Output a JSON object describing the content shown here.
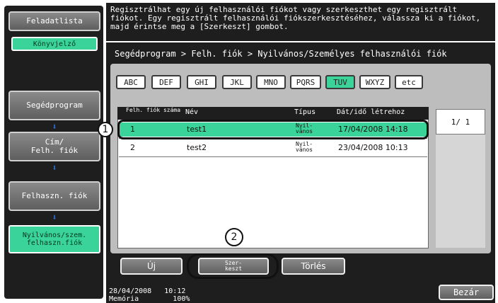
{
  "sidebar": {
    "tab_feladatlista": "Feladatlista",
    "tab_konyvjelzo": "Könyvjelző",
    "steps": [
      "Segédprogram",
      "Cím/\nFelh. fiók",
      "Felhaszn. fiók",
      "Nyilvános/szem.\nfelhaszn.fiók"
    ],
    "arrow_glyph": "⬇"
  },
  "message": "Regisztrálhat egy új felhasználói fiókot vagy szerkeszthet egy regisztrált fiókot. Egy regisztrált felhasználói fiókszerkesztéséhez, válassza ki a fiókot, majd érintse meg a [Szerkeszt] gombot.",
  "breadcrumb": "Segédprogram > Felh. fiók > Nyilvános/Személyes felhasználói fiók",
  "tabs": [
    "ABC",
    "DEF",
    "GHI",
    "JKL",
    "MNO",
    "PQRS",
    "TUV",
    "WXYZ",
    "etc"
  ],
  "active_tab": "TUV",
  "list": {
    "headers": {
      "num": "Felh. fiók száma",
      "name": "Név",
      "type": "Típus",
      "date": "Dát/idő létrehoz"
    },
    "rows": [
      {
        "num": "1",
        "name": "test1",
        "type": "Nyil-\nvános",
        "date": "17/04/2008 14:18"
      },
      {
        "num": "2",
        "name": "test2",
        "type": "Nyil-\nvános",
        "date": "23/04/2008 10:13"
      }
    ]
  },
  "pager": "1/ 1",
  "actions": {
    "new": "Új",
    "edit": "Szer-\nkeszt",
    "delete": "Törlés"
  },
  "status": {
    "datetime": "28/04/2008   10:12",
    "memory": "Memória        100%"
  },
  "close": "Bezár",
  "callouts": {
    "one": "1",
    "two": "2"
  },
  "colors": {
    "accent": "#3ad39a",
    "panel": "#1e1e1e",
    "inner": "#bdbdbd"
  }
}
